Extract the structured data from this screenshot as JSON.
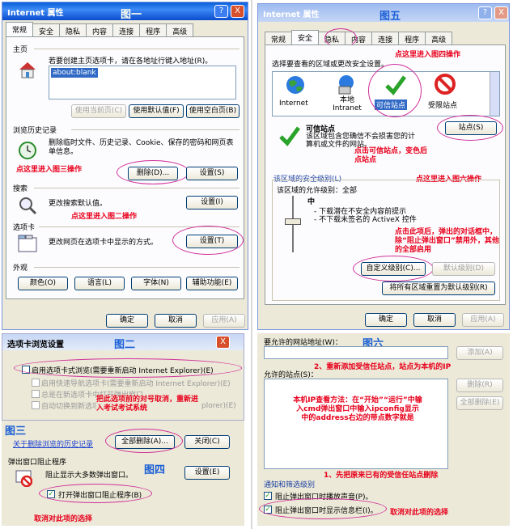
{
  "p1": {
    "title": "Internet 属性",
    "caption": "图一",
    "help": "?",
    "close": "X",
    "tabs": [
      "常规",
      "安全",
      "隐私",
      "内容",
      "连接",
      "程序",
      "高级"
    ],
    "home_label": "主页",
    "home_desc": "若要创建主页选项卡，请在各地址行键入地址(R)。",
    "home_url": "about:blank",
    "btn_current": "使用当前页(C)",
    "btn_default": "使用默认值(F)",
    "btn_blank": "使用空白页(B)",
    "history_label": "浏览历史记录",
    "history_desc": "删除临时文件、历史记录、Cookie、保存的密码和网页表单信息。",
    "note_fig3": "点这里进入图三操作",
    "btn_delete": "删除(D)...",
    "btn_settings1": "设置(S)",
    "search_label": "搜索",
    "search_desc": "更改搜索默认值。",
    "btn_settings2": "设置(I)",
    "note_fig2": "点这里进入图二操作",
    "tabs_label": "选项卡",
    "tabs_desc": "更改网页在选项卡中显示的方式。",
    "btn_settings3": "设置(T)",
    "appearance_label": "外观",
    "btn_colors": "颜色(O)",
    "btn_lang": "语言(L)",
    "btn_fonts": "字体(N)",
    "btn_access": "辅助功能(E)",
    "btn_ok": "确定",
    "btn_cancel": "取消",
    "btn_apply": "应用(A)"
  },
  "p5": {
    "title": "Internet 属性",
    "caption": "图五",
    "help": "?",
    "close": "X",
    "tabs": [
      "常规",
      "安全",
      "隐私",
      "内容",
      "连接",
      "程序",
      "高级"
    ],
    "note_fig4": "点这里进入图四操作",
    "zone_prompt": "选择要查看的区域或更改安全设置。",
    "zones": [
      "Internet",
      "本地 Intranet",
      "可信站点",
      "受限站点"
    ],
    "trusted_title": "可信站点",
    "trusted_desc": "该区域包含您确信不会损害您的计算机或文件的网站。",
    "btn_sites": "站点(S)",
    "note_trusted": "点击可信站点，变色后点站点",
    "note_fig6": "点这里进入图六操作",
    "level_label": "该区域的安全级别(L)",
    "allowed_label": "该区域的允许级别：全部",
    "level_name": "中",
    "level_desc1": "- 下载潜在不安全内容前提示",
    "level_desc2": "- 不下载未签名的 ActiveX 控件",
    "note_custom": "点击此项后，弹出的对话框中，除“阻止弹出窗口”禁用外，其他的全部启用",
    "btn_custom": "自定义级别(C)...",
    "btn_default_level": "默认级别(D)",
    "btn_reset": "将所有区域重置为默认级别(R)",
    "btn_ok": "确定",
    "btn_cancel": "取消",
    "btn_apply": "应用(A)"
  },
  "p2": {
    "title": "选项卡浏览设置",
    "caption": "图二",
    "close": "X",
    "opt1": "启用选项卡式浏览(需要重新启动 Internet Explorer)(E)",
    "opt2": "启用快速导航选项卡(需要重新启动 Internet Explorer)(E)",
    "opt3": "总是在新选项卡中打开弹出窗口",
    "opt4": "自动切换到新选项卡",
    "note": "把此选项前的对号取消，重新进入考试考试系统",
    "ghost": "plorer)(E)"
  },
  "p3": {
    "caption": "图三",
    "link": "关于删除浏览的历史记录",
    "btn_delall": "全部删除(A)...",
    "btn_close": "关闭(C)"
  },
  "p4": {
    "caption": "图四",
    "title": "弹出窗口阻止程序",
    "desc": "阻止显示大多数弹出窗口。",
    "btn_settings": "设置(E)",
    "chk_label": "打开弹出窗口阻止程序(B)",
    "note": "取消对此项的选择"
  },
  "p6": {
    "caption": "图六",
    "add_label": "要允许的网站地址(W)：",
    "btn_add": "添加(A)",
    "note_readd": "2、重新添加受信任站点，站点为本机的IP",
    "allowed_label": "允许的站点(S)：",
    "btn_remove": "删除(R)",
    "btn_removeall": "全部删除(E)",
    "note_ip": "本机IP查看方法：在“开始”“运行”中输入cmd弹出窗口中输入ipconfig显示中的address右边的带点数字就是",
    "note_delete": "1、先把原来已有的受信任站点删除",
    "group_label": "通知和筛选级别",
    "chk1": "阻止弹出窗口时播放声音(P)。",
    "chk2": "阻止弹出窗口时显示信息栏(I)。",
    "note_uncheck": "取消对此项的选择"
  }
}
